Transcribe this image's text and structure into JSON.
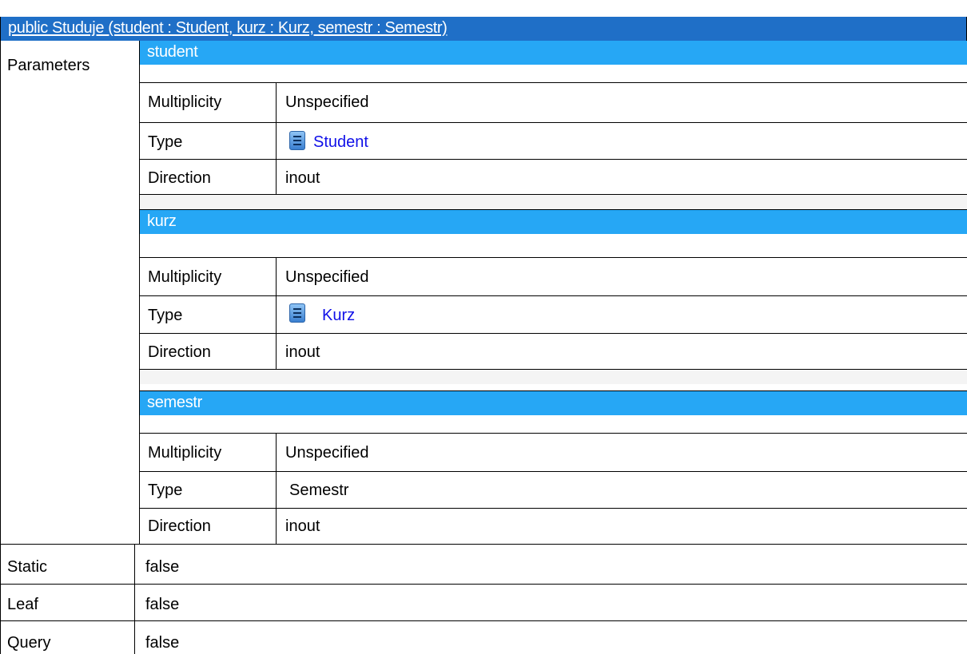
{
  "colors": {
    "title_bar": "#1f6fc7",
    "param_header": "#26a7f5",
    "gap_row": "#f4f4f4",
    "link": "#1010e8"
  },
  "operation": {
    "signature": "public Studuje (student : Student, kurz : Kurz, semestr : Semestr)"
  },
  "rows": {
    "parameters_label": "Parameters",
    "static_label": "Static",
    "static_value": "false",
    "leaf_label": "Leaf",
    "leaf_value": "false",
    "query_label": "Query",
    "query_value": "false"
  },
  "parameters": [
    {
      "name": "student",
      "multiplicity_label": "Multiplicity",
      "multiplicity": "Unspecified",
      "type_label": "Type",
      "type": "Student",
      "type_is_link": true,
      "type_icon": "class-icon",
      "direction_label": "Direction",
      "direction": "inout"
    },
    {
      "name": "kurz",
      "multiplicity_label": "Multiplicity",
      "multiplicity": "Unspecified",
      "type_label": "Type",
      "type": "Kurz",
      "type_is_link": true,
      "type_icon": "class-icon",
      "direction_label": "Direction",
      "direction": "inout"
    },
    {
      "name": "semestr",
      "multiplicity_label": "Multiplicity",
      "multiplicity": "Unspecified",
      "type_label": "Type",
      "type": "Semestr",
      "type_is_link": false,
      "direction_label": "Direction",
      "direction": "inout"
    }
  ]
}
